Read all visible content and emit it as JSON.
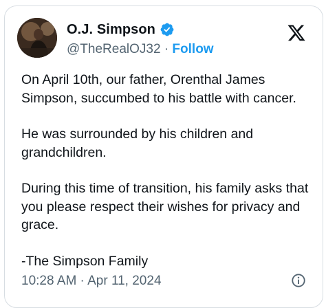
{
  "author": {
    "display_name": "O.J. Simpson",
    "handle": "@TheRealOJ32",
    "separator": "·",
    "follow_label": "Follow"
  },
  "post": {
    "paragraphs": [
      "On April 10th, our father, Orenthal James Simpson, succumbed to his battle with cancer.",
      "He was surrounded by his children and grandchildren.",
      "During this time of transition, his family asks that you please respect their wishes for privacy and grace.",
      "-The Simpson Family"
    ],
    "timestamp": "10:28 AM · Apr 11, 2024"
  },
  "icons": {
    "verified": "verified-badge-icon",
    "platform": "x-logo-icon",
    "info": "info-icon"
  },
  "colors": {
    "accent": "#1d9bf0",
    "text": "#0f1419",
    "secondary": "#536471",
    "border": "#d7dde2"
  }
}
